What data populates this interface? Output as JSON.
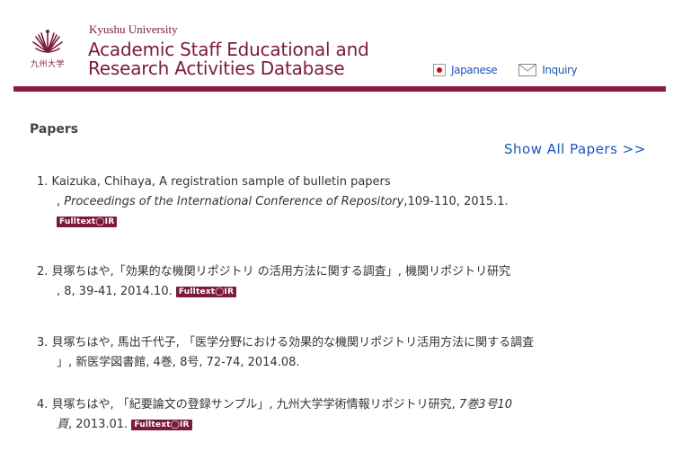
{
  "header": {
    "logo_text": "九州大学",
    "university": "Kyushu University",
    "title_line1": "Academic Staff Educational and",
    "title_line2": "Research Activities Database",
    "nav": {
      "japanese": "Japanese",
      "inquiry": "Inquiry"
    }
  },
  "main": {
    "section_title": "Papers",
    "show_all": "Show All Papers >>",
    "badge_label": "Fulltext◯IR",
    "papers": [
      {
        "num": "1.",
        "line1": "Kaizuka, Chihaya, A registration sample of bulletin papers",
        "line2_prefix": ", ",
        "line2_italic": "Proceedings of the International Conference of Repository",
        "line2_suffix": ",109-110, 2015.1.",
        "has_badge": true
      },
      {
        "num": "2.",
        "line1": "貝塚ちはや,「効果的な機関リポジトリ の活用方法に関する調査」, 機関リポジトリ研究",
        "line2": ", 8, 39-41, 2014.10.",
        "has_badge": true
      },
      {
        "num": "3.",
        "line1": "貝塚ちはや, 馬出千代子, 「医学分野における効果的な機関リポジトリ活用方法に関する調査",
        "line2": "」, 新医学図書館, 4巻, 8号, 72-74, 2014.08.",
        "has_badge": false
      },
      {
        "num": "4.",
        "line1_plain": "貝塚ちはや, 「紀要論文の登録サンプル」, 九州大学学術情報リポジトリ研究, ",
        "line1_italic": "7巻3号10",
        "line2_italic": "頁",
        "line2_suffix": ", 2013.01.",
        "has_badge": true
      }
    ]
  },
  "colors": {
    "brand": "#8a1d3c",
    "link": "#1a56b8"
  }
}
